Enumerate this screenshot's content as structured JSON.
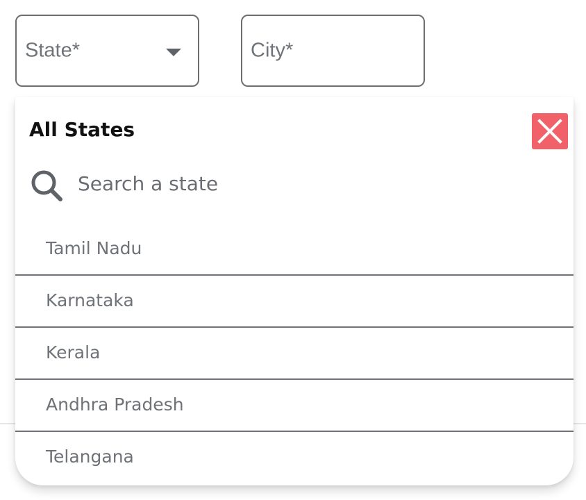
{
  "form": {
    "state_field": {
      "placeholder": "State*",
      "icon": "dropdown-arrow-icon"
    },
    "city_field": {
      "placeholder": "City*"
    }
  },
  "dropdown": {
    "title": "All States",
    "close_icon": "close-icon",
    "close_color": "#f0616a",
    "search": {
      "icon": "search-icon",
      "placeholder": "Search a state",
      "value": ""
    },
    "states": [
      {
        "label": "Tamil Nadu"
      },
      {
        "label": "Karnataka"
      },
      {
        "label": "Kerala"
      },
      {
        "label": "Andhra Pradesh"
      },
      {
        "label": "Telangana"
      }
    ]
  }
}
